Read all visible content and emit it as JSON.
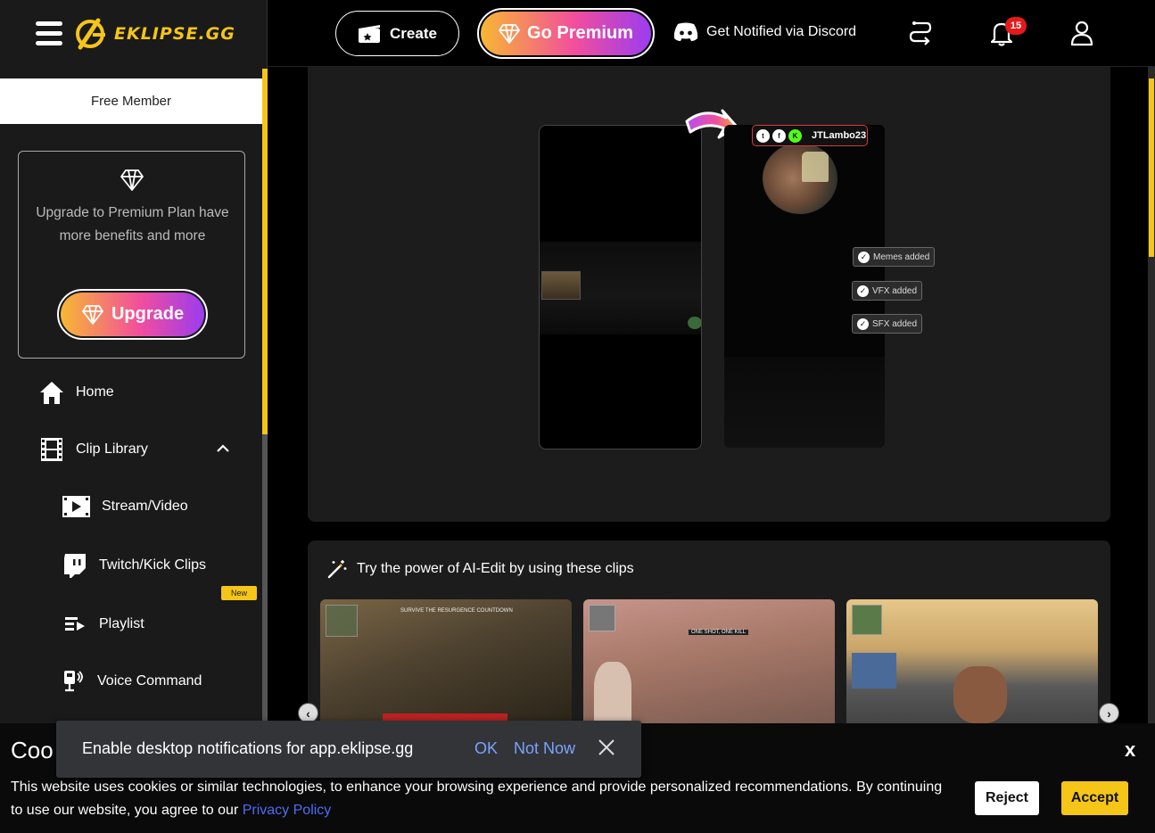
{
  "header": {
    "logo_text": "EKLIPSE.GG",
    "create_label": "Create",
    "premium_label": "Go Premium",
    "discord_label": "Get Notified via Discord",
    "notification_count": "15"
  },
  "sidebar": {
    "member_status": "Free Member",
    "upgrade_text": "Upgrade to Premium Plan have more benefits and more",
    "upgrade_button": "Upgrade",
    "items": [
      {
        "label": "Home",
        "icon": "home-icon"
      },
      {
        "label": "Clip Library",
        "icon": "film-icon"
      },
      {
        "label": "Stream/Video",
        "icon": "video-icon"
      },
      {
        "label": "Twitch/Kick Clips",
        "icon": "twitch-icon"
      },
      {
        "label": "Playlist",
        "icon": "playlist-icon"
      },
      {
        "label": "Voice Command",
        "icon": "voice-command-icon"
      }
    ],
    "new_tag": "New"
  },
  "preview": {
    "streamer_name": "JTLambo23",
    "tags": [
      "Memes added",
      "VFX added",
      "SFX added"
    ]
  },
  "ai_edit": {
    "title": "Try the power of AI-Edit by using these clips",
    "thumb_texts": [
      "SURVIVE THE RESURGENCE COUNTDOWN",
      "ONE SHOT, ONE KILL"
    ]
  },
  "cookie": {
    "title": "Coo",
    "text": "This website uses cookies or similar technologies, to enhance your browsing experience and provide personalized recommendations. By continuing to use our website, you agree to our ",
    "link": "Privacy Policy",
    "close": "x",
    "reject": "Reject",
    "accept": "Accept"
  },
  "notification_prompt": {
    "text": "Enable desktop notifications for app.eklipse.gg",
    "ok": "OK",
    "not_now": "Not Now"
  },
  "colors": {
    "accent": "#f5c518",
    "premium_gradient_start": "#f7b733",
    "premium_gradient_mid": "#f24e9c",
    "premium_gradient_end": "#9b3cf0",
    "link": "#4d6cf7"
  }
}
